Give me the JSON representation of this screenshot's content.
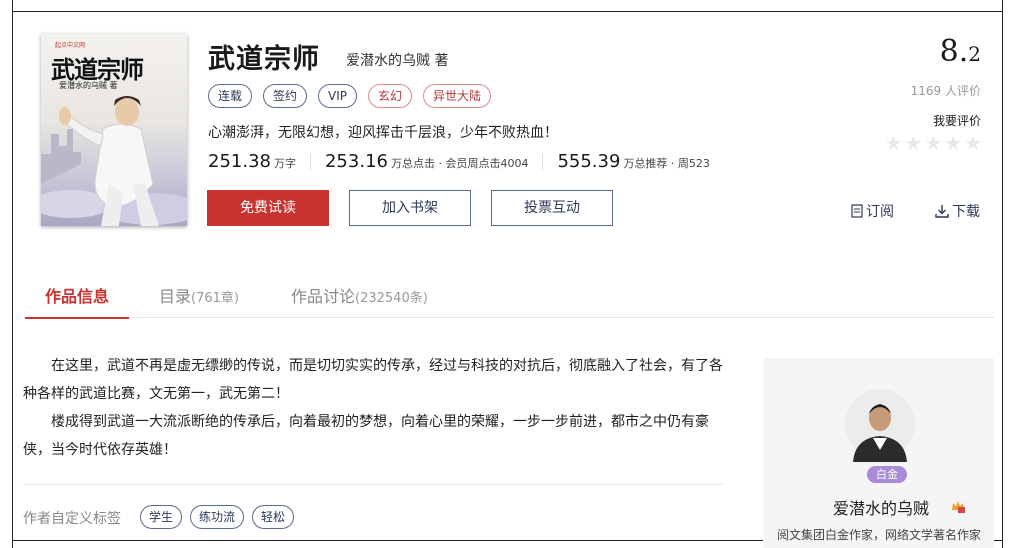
{
  "book": {
    "title": "武道宗师",
    "author": "爱潜水的乌贼 著",
    "tags": [
      {
        "label": "连载",
        "style": "normal"
      },
      {
        "label": "签约",
        "style": "normal"
      },
      {
        "label": "VIP",
        "style": "normal"
      },
      {
        "label": "玄幻",
        "style": "red"
      },
      {
        "label": "异世大陆",
        "style": "red"
      }
    ],
    "slogan": "心潮澎湃，无限幻想，迎风挥击千层浪，少年不败热血！",
    "stats": {
      "words_num": "251.38",
      "words_unit": "万字",
      "clicks_num": "253.16",
      "clicks_unit": "万总点击 · 会员周点击4004",
      "recs_num": "555.39",
      "recs_unit": "万总推荐 · 周523"
    }
  },
  "cover": {
    "title": "武道宗师",
    "author": "爱潜水的乌贼 著",
    "publisher": "起点中文网"
  },
  "buttons": {
    "read": "免费试读",
    "shelf": "加入书架",
    "vote": "投票互动"
  },
  "rating": {
    "score_int": "8.",
    "score_dec": "2",
    "count": "1169 人评价",
    "rate_link": "我要评价",
    "stars_filled": 0,
    "stars_total": 5
  },
  "actions": {
    "subscribe": "订阅",
    "download": "下载"
  },
  "tabs": [
    {
      "label": "作品信息",
      "count": ""
    },
    {
      "label": "目录",
      "count": "(761章)"
    },
    {
      "label": "作品讨论",
      "count": "(232540条)"
    }
  ],
  "intro": {
    "p1": "在这里，武道不再是虚无缥缈的传说，而是切切实实的传承，经过与科技的对抗后，彻底融入了社会，有了各种各样的武道比赛，文无第一，武无第二！",
    "p2": "楼成得到武道一大流派断绝的传承后，向着最初的梦想，向着心里的荣耀，一步一步前进，都市之中仍有豪侠，当今时代依存英雄！"
  },
  "custom_tags": {
    "label": "作者自定义标签",
    "items": [
      "学生",
      "练功流",
      "轻松"
    ]
  },
  "author_card": {
    "name": "爱潜水的乌贼",
    "level": "白金",
    "desc": "阅文集团白金作家，网络文学著名作家"
  },
  "colors": {
    "accent": "#c8322f",
    "tag_border": "#5b6b8c",
    "level_badge": "#a98bd8"
  }
}
